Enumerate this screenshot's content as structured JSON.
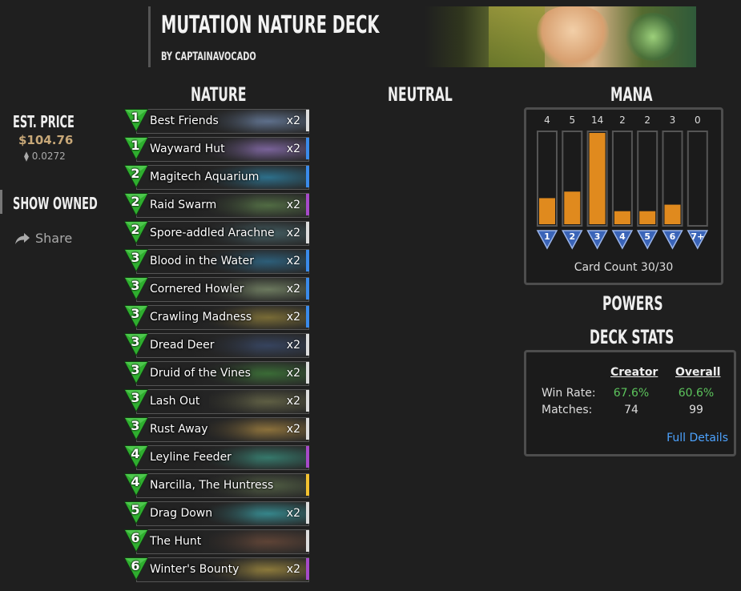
{
  "deck": {
    "title": "MUTATION NATURE DECK",
    "author": "BY CAPTAINAVOCADO",
    "est_price_label": "EST. PRICE",
    "price": "$104.76",
    "price_eth": "⧫ 0.0272",
    "show_owned": "SHOW OWNED",
    "share": "Share"
  },
  "columns": {
    "nature": "NATURE",
    "neutral": "NEUTRAL",
    "mana": "MANA"
  },
  "cards": [
    {
      "cost": "1",
      "name": "Best Friends",
      "qty": "x2",
      "rarity": "common",
      "art": "#6a7fa0"
    },
    {
      "cost": "1",
      "name": "Wayward Hut",
      "qty": "x2",
      "rarity": "rare",
      "art": "#8a6fb0"
    },
    {
      "cost": "2",
      "name": "Magitech Aquarium",
      "qty": "",
      "rarity": "rare",
      "art": "#2f7fa0"
    },
    {
      "cost": "2",
      "name": "Raid Swarm",
      "qty": "x2",
      "rarity": "epic",
      "art": "#5a7a4a"
    },
    {
      "cost": "2",
      "name": "Spore-addled Arachne",
      "qty": "x2",
      "rarity": "common",
      "art": "#4a6a70"
    },
    {
      "cost": "3",
      "name": "Blood in the Water",
      "qty": "x2",
      "rarity": "rare",
      "art": "#2f6a8a"
    },
    {
      "cost": "3",
      "name": "Cornered Howler",
      "qty": "x2",
      "rarity": "rare",
      "art": "#7a8a6a"
    },
    {
      "cost": "3",
      "name": "Crawling Madness",
      "qty": "x2",
      "rarity": "rare",
      "art": "#8a7a3a"
    },
    {
      "cost": "3",
      "name": "Dread Deer",
      "qty": "x2",
      "rarity": "common",
      "art": "#3a4a6a"
    },
    {
      "cost": "3",
      "name": "Druid of the Vines",
      "qty": "x2",
      "rarity": "common",
      "art": "#3f7a3a"
    },
    {
      "cost": "3",
      "name": "Lash Out",
      "qty": "x2",
      "rarity": "common",
      "art": "#6a6a4a"
    },
    {
      "cost": "3",
      "name": "Rust Away",
      "qty": "x2",
      "rarity": "common",
      "art": "#a08040"
    },
    {
      "cost": "4",
      "name": "Leyline Feeder",
      "qty": "",
      "rarity": "epic",
      "art": "#3a8a7a"
    },
    {
      "cost": "4",
      "name": "Narcilla, The Huntress",
      "qty": "",
      "rarity": "legendary",
      "art": "#5a6a4a"
    },
    {
      "cost": "5",
      "name": "Drag Down",
      "qty": "x2",
      "rarity": "common",
      "art": "#3a9aa0"
    },
    {
      "cost": "6",
      "name": "The Hunt",
      "qty": "",
      "rarity": "common",
      "art": "#6a4a3a"
    },
    {
      "cost": "6",
      "name": "Winter's Bounty",
      "qty": "x2",
      "rarity": "epic",
      "art": "#a08a40"
    }
  ],
  "rarity_colors": {
    "common": "#dddddd",
    "rare": "#3a8bea",
    "epic": "#a64ac9",
    "legendary": "#f2c230"
  },
  "mana": {
    "counts": [
      "4",
      "5",
      "14",
      "2",
      "2",
      "3",
      "0"
    ],
    "costs": [
      "1",
      "2",
      "3",
      "4",
      "5",
      "6",
      "7+"
    ],
    "max": 14,
    "card_count": "Card Count 30/30",
    "bar_color": "#e08a1e"
  },
  "powers_title": "POWERS",
  "stats": {
    "title": "DECK STATS",
    "creator_label": "Creator",
    "overall_label": "Overall",
    "win_rate_label": "Win Rate:",
    "matches_label": "Matches:",
    "creator_win_rate": "67.6%",
    "overall_win_rate": "60.6%",
    "creator_matches": "74",
    "overall_matches": "99",
    "full_details": "Full Details",
    "win_color": "#5cc45c"
  }
}
